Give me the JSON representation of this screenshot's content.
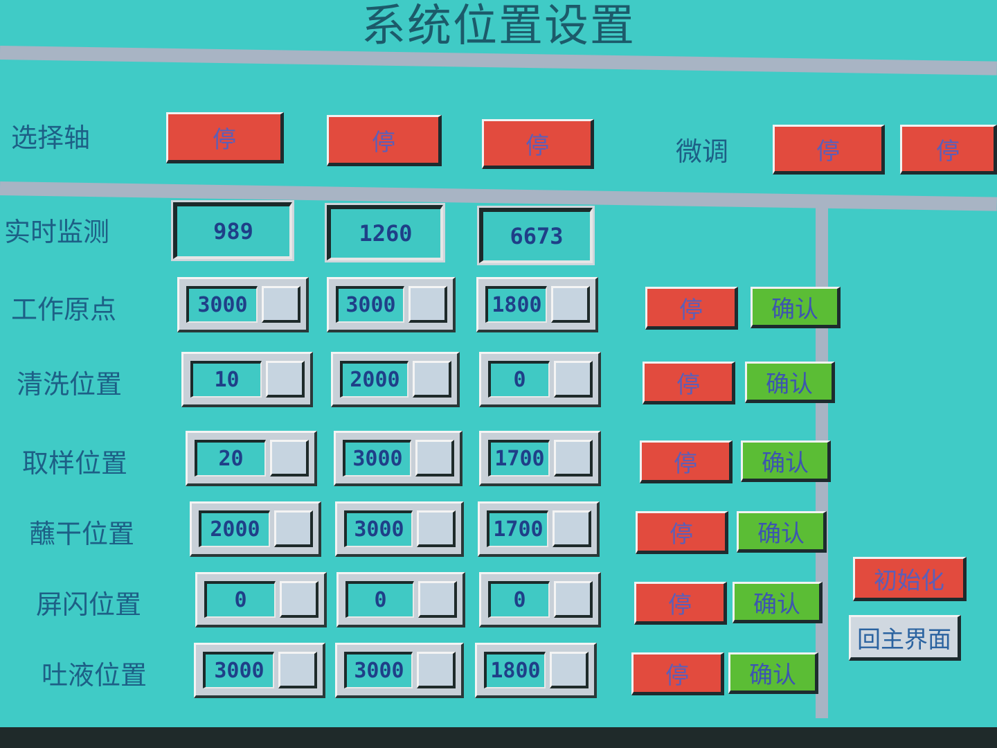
{
  "title": "系统位置设置",
  "axis_row": {
    "label": "选择轴",
    "axis_buttons": [
      "停",
      "停",
      "停"
    ],
    "fine_tune_label": "微调",
    "fine_tune_buttons": [
      "停",
      "停"
    ]
  },
  "monitor": {
    "label": "实时监测",
    "values": [
      "989",
      "1260",
      "6673"
    ]
  },
  "positions": [
    {
      "label": "工作原点",
      "values": [
        "3000",
        "3000",
        "1800"
      ],
      "stop": "停",
      "confirm": "确认"
    },
    {
      "label": "清洗位置",
      "values": [
        "10",
        "2000",
        "0"
      ],
      "stop": "停",
      "confirm": "确认"
    },
    {
      "label": "取样位置",
      "values": [
        "20",
        "3000",
        "1700"
      ],
      "stop": "停",
      "confirm": "确认"
    },
    {
      "label": "蘸干位置",
      "values": [
        "2000",
        "3000",
        "1700"
      ],
      "stop": "停",
      "confirm": "确认"
    },
    {
      "label": "屏闪位置",
      "values": [
        "0",
        "0",
        "0"
      ],
      "stop": "停",
      "confirm": "确认"
    },
    {
      "label": "吐液位置",
      "values": [
        "3000",
        "3000",
        "1800"
      ],
      "stop": "停",
      "confirm": "确认"
    }
  ],
  "side": {
    "init_label": "初始化",
    "home_label": "回主界面"
  },
  "colors": {
    "background": "#40cbc6",
    "stop_button": "#e24b3e",
    "confirm_button": "#5bbd35",
    "divider": "#a8b4c4"
  }
}
